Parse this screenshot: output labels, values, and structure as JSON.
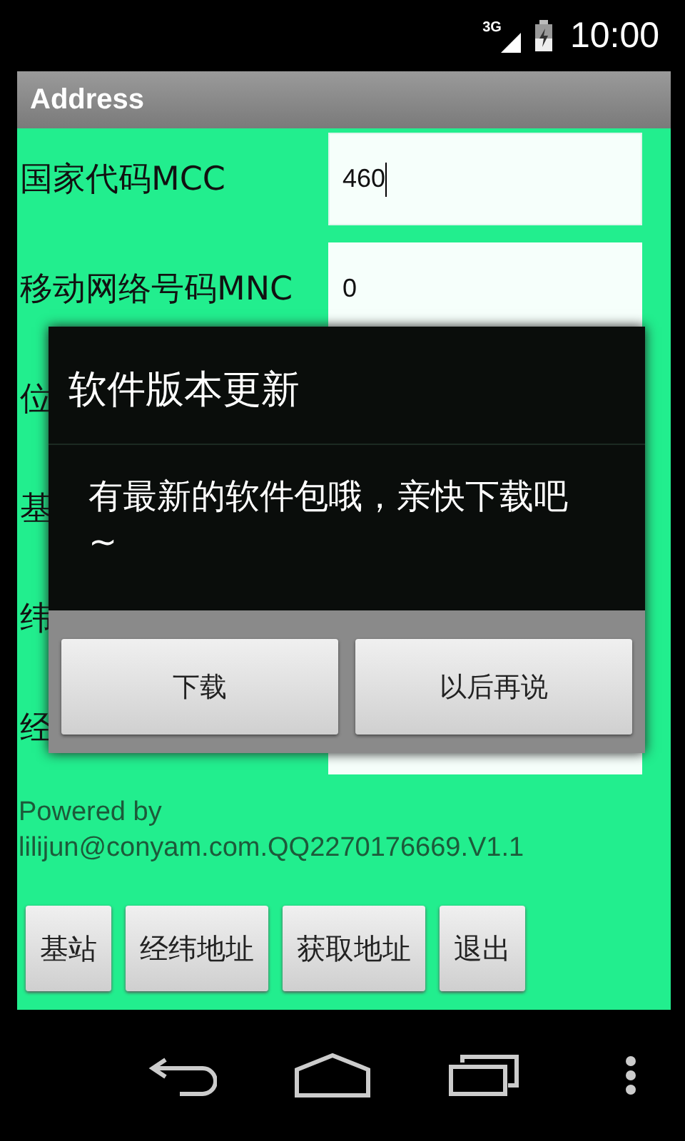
{
  "status_bar": {
    "network": "3G",
    "time": "10:00"
  },
  "window": {
    "title": "Address"
  },
  "fields": [
    {
      "label": "国家代码MCC",
      "value": "460",
      "focused": true
    },
    {
      "label": "移动网络号码MNC",
      "value": "0",
      "focused": false
    },
    {
      "label": "位"
    },
    {
      "label": "基"
    },
    {
      "label": "纬"
    },
    {
      "label": "经"
    }
  ],
  "footer": {
    "credit": "Powered by lilijun@conyam.com.QQ2270176669.V1.1"
  },
  "buttons": [
    "基站",
    "经纬地址",
    "获取地址",
    "退出"
  ],
  "dialog": {
    "title": "软件版本更新",
    "message": "有最新的软件包哦，亲快下载吧~",
    "buttons": [
      "下载",
      "以后再说"
    ]
  }
}
